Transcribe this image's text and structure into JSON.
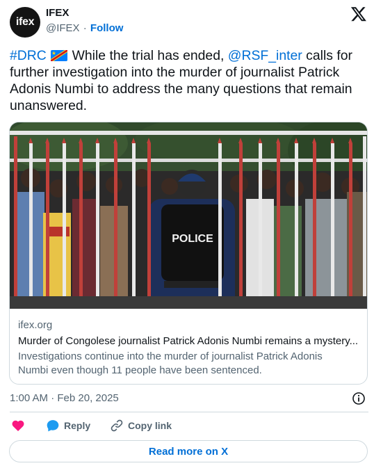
{
  "account": {
    "avatar_text": "ifex",
    "name": "IFEX",
    "handle": "@IFEX",
    "separator": "·",
    "follow_label": "Follow"
  },
  "tweet": {
    "hashtag": "#DRC",
    "flag_icon": "drc-flag-icon",
    "text_part1": " While the trial has ended, ",
    "mention": "@RSF_inter",
    "text_part2": " calls for further investigation into the murder of journalist Patrick Adonis Numbi to address the many questions that remain unanswered."
  },
  "card": {
    "image_police_text": "POLICE",
    "domain": "ifex.org",
    "title": "Murder of Congolese journalist Patrick Adonis Numbi remains a mystery...",
    "description": "Investigations continue into the murder of journalist Patrick Adonis Numbi even though 11 people have been sentenced."
  },
  "meta": {
    "timestamp": "1:00 AM · Feb 20, 2025"
  },
  "actions": {
    "like_icon": "heart-icon",
    "reply_label": "Reply",
    "copy_link_label": "Copy link"
  },
  "footer": {
    "read_more_label": "Read more on X"
  },
  "colors": {
    "link": "#006fd6",
    "text": "#0f1419",
    "muted": "#536471",
    "border": "#cfd9de",
    "heart": "#f91880",
    "reply_bubble": "#1d9bf0"
  }
}
